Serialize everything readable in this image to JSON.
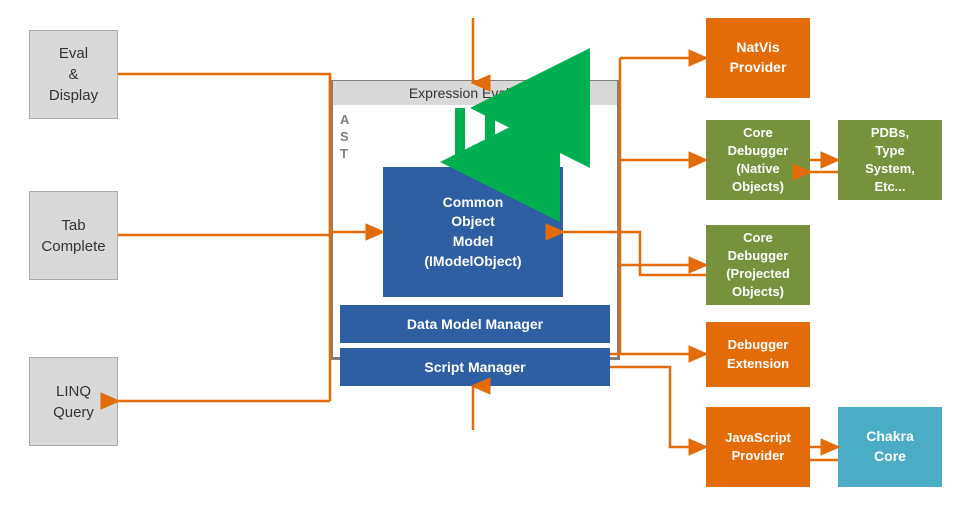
{
  "boxes": {
    "eval_display": {
      "label": "Eval\n&\nDisplay"
    },
    "tab_complete": {
      "label": "Tab\nComplete"
    },
    "linq_query": {
      "label": "LINQ\nQuery"
    },
    "expression_evaluator": {
      "label": "Expression Evaluator"
    },
    "ast": {
      "label": "A\nS\nT"
    },
    "common_object_model": {
      "label": "Common\nObject\nModel\n(IModelObject)"
    },
    "data_model_manager": {
      "label": "Data Model Manager"
    },
    "script_manager": {
      "label": "Script Manager"
    },
    "natvis_provider": {
      "label": "NatVis\nProvider"
    },
    "core_debugger_native": {
      "label": "Core\nDebugger\n(Native\nObjects)"
    },
    "pdbs": {
      "label": "PDBs,\nType\nSystem,\nEtc..."
    },
    "core_debugger_projected": {
      "label": "Core\nDebugger\n(Projected\nObjects)"
    },
    "debugger_extension": {
      "label": "Debugger\nExtension"
    },
    "javascript_provider": {
      "label": "JavaScript\nProvider"
    },
    "chakra_core": {
      "label": "Chakra\nCore"
    }
  }
}
